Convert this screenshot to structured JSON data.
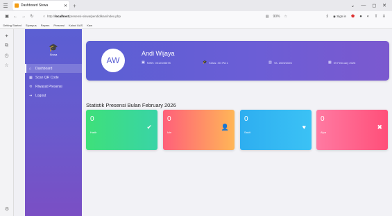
{
  "browser": {
    "tab_title": "Dashboard Siswa",
    "url_prefix": "http://",
    "url_host": "localhost",
    "url_path": "/presensi-siswa/pendidikan/index.php",
    "zoom": "90%",
    "sign_in": "Sign in",
    "bookmarks": [
      "Getting Started",
      "Siperpus",
      "Papers",
      "Presensi",
      "Kaisol UAS",
      "Kaw"
    ]
  },
  "sidebar": {
    "brand": "Siswa",
    "items": [
      {
        "label": "Dashboard",
        "icon": "home-icon",
        "active": true
      },
      {
        "label": "Scan QR Code",
        "icon": "qr-icon",
        "active": false
      },
      {
        "label": "Riwayat Presensi",
        "icon": "history-icon",
        "active": false
      },
      {
        "label": "Logout",
        "icon": "logout-icon",
        "active": false
      }
    ]
  },
  "profile": {
    "initials": "AW",
    "name": "Andi Wijaya",
    "nisn": "NISN: 0012345678",
    "kelas": "Kelas: XII IPA 1",
    "tahun": "TA: 2025/2026",
    "tanggal": "09 February 2026"
  },
  "stats": {
    "title": "Statistik Presensi Bulan February 2026",
    "cards": [
      {
        "value": "0",
        "label": "Hadir",
        "icon": "check-circle-icon"
      },
      {
        "value": "0",
        "label": "Izin",
        "icon": "user-icon"
      },
      {
        "value": "0",
        "label": "Sakit",
        "icon": "heart-icon"
      },
      {
        "value": "0",
        "label": "Alpa",
        "icon": "close-circle-icon"
      }
    ]
  },
  "colors": {
    "primary": "#5b5fd3",
    "hadir": "#3ee07a",
    "izin": "#ff5f7a",
    "sakit": "#2eaef0",
    "alpa": "#ff4f79"
  }
}
